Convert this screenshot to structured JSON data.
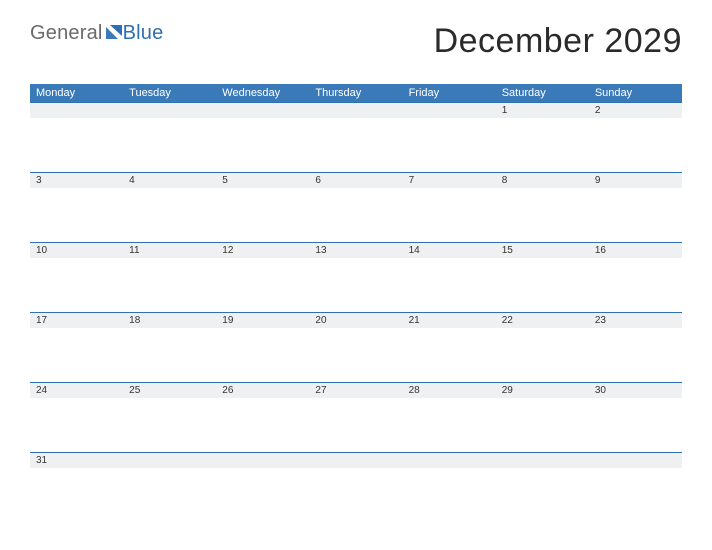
{
  "logo": {
    "part1": "General",
    "part2": "Blue"
  },
  "title": "December 2029",
  "dow": [
    "Monday",
    "Tuesday",
    "Wednesday",
    "Thursday",
    "Friday",
    "Saturday",
    "Sunday"
  ],
  "weeks": [
    [
      "",
      "",
      "",
      "",
      "",
      "1",
      "2"
    ],
    [
      "3",
      "4",
      "5",
      "6",
      "7",
      "8",
      "9"
    ],
    [
      "10",
      "11",
      "12",
      "13",
      "14",
      "15",
      "16"
    ],
    [
      "17",
      "18",
      "19",
      "20",
      "21",
      "22",
      "23"
    ],
    [
      "24",
      "25",
      "26",
      "27",
      "28",
      "29",
      "30"
    ],
    [
      "31",
      "",
      "",
      "",
      "",
      "",
      ""
    ]
  ]
}
